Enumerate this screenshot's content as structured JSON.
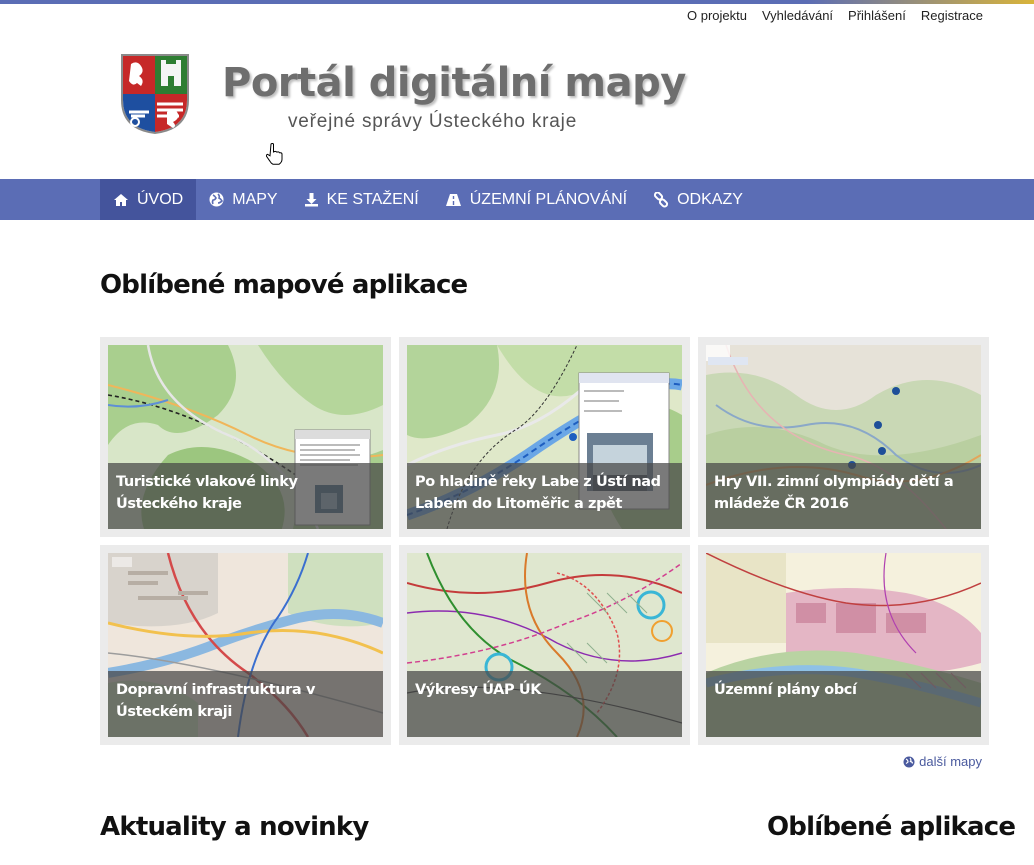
{
  "colors": {
    "brand": "#5b6db5",
    "brand_active": "#44549c",
    "accent": "#d9b43a",
    "link": "#4a5a9e"
  },
  "toplinks": [
    {
      "label": "O projektu"
    },
    {
      "label": "Vyhledávání"
    },
    {
      "label": "Přihlášení"
    },
    {
      "label": "Registrace"
    }
  ],
  "header": {
    "title": "Portál digitální mapy",
    "subtitle": "veřejné správy Ústeckého kraje"
  },
  "nav": [
    {
      "label": "ÚVOD",
      "icon": "home-icon",
      "active": true
    },
    {
      "label": "MAPY",
      "icon": "globe-icon",
      "active": false
    },
    {
      "label": "KE STAŽENÍ",
      "icon": "download-icon",
      "active": false
    },
    {
      "label": "ÚZEMNÍ PLÁNOVÁNÍ",
      "icon": "road-icon",
      "active": false
    },
    {
      "label": "ODKAZY",
      "icon": "link-icon",
      "active": false
    }
  ],
  "sections": {
    "favorite_maps": "Oblíbené mapové aplikace",
    "news": "Aktuality a novinky",
    "favorite_apps": "Oblíbené aplikace"
  },
  "tiles": [
    {
      "caption": "Turistické vlakové linky Ústeckého kraje"
    },
    {
      "caption": "Po hladině řeky Labe z Ústí nad Labem do Litoměřic a zpět"
    },
    {
      "caption": "Hry VII. zimní olympiády dětí a mládeže ČR 2016"
    },
    {
      "caption": "Dopravní infrastruktura v Ústeckém kraji"
    },
    {
      "caption": "Výkresy ÚAP ÚK"
    },
    {
      "caption": "Územní plány obcí"
    }
  ],
  "more_maps": "další mapy"
}
